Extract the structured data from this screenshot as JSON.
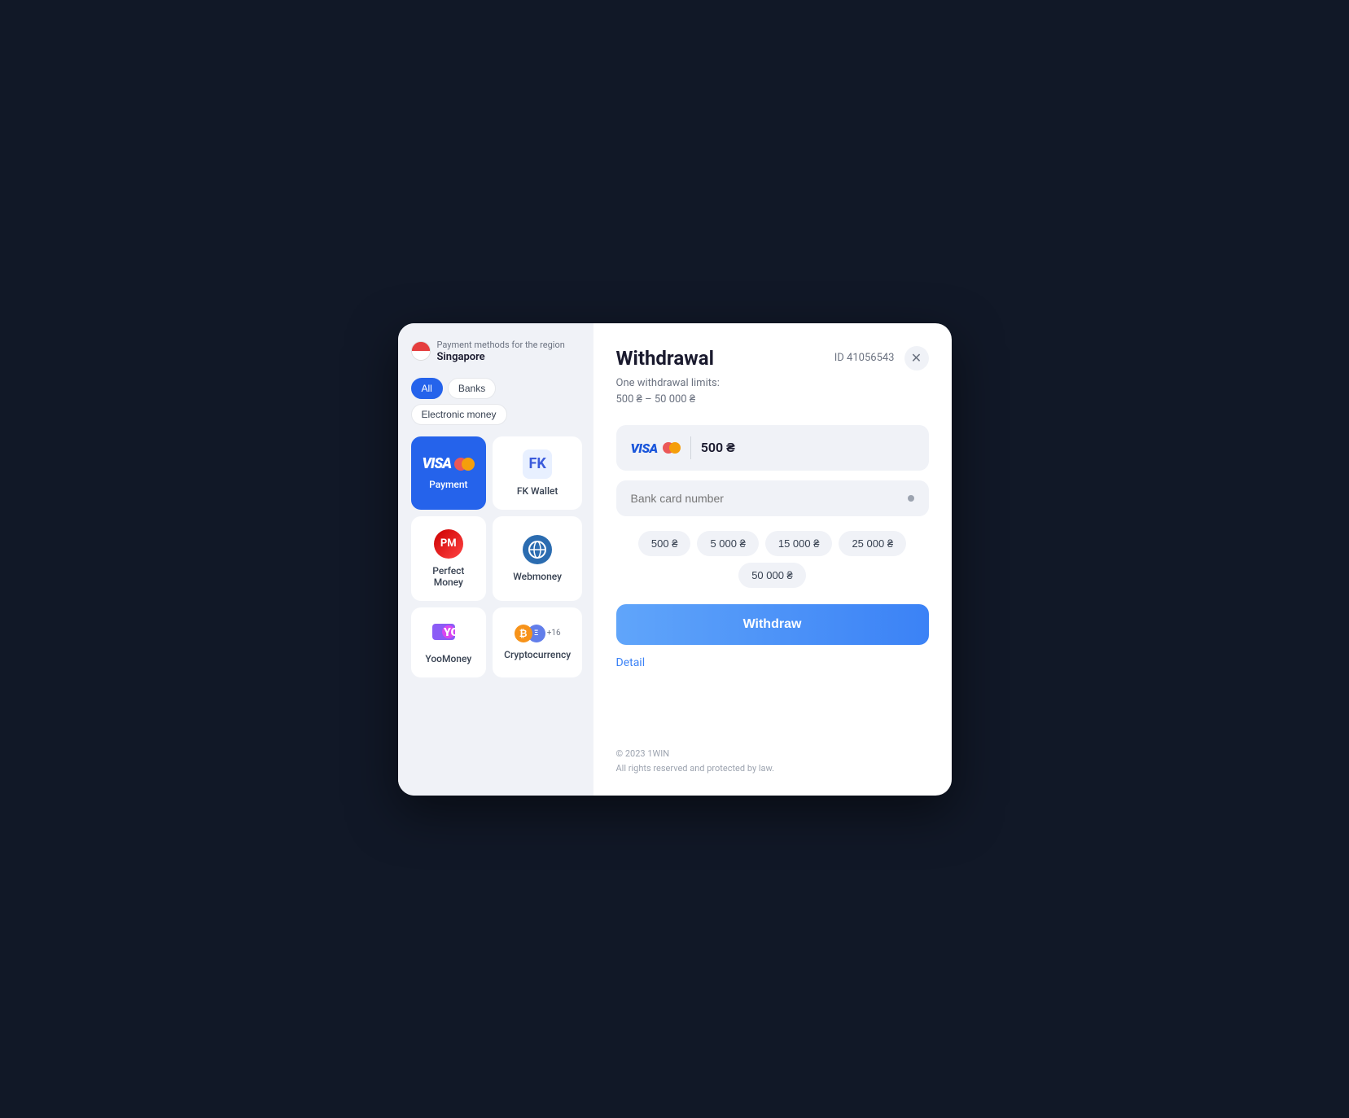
{
  "page": {
    "bg_color": "#111827"
  },
  "modal": {
    "left": {
      "region_label": "Payment methods for the region",
      "region_name": "Singapore",
      "filters": [
        {
          "id": "all",
          "label": "All",
          "active": true
        },
        {
          "id": "banks",
          "label": "Banks",
          "active": false
        },
        {
          "id": "electronic",
          "label": "Electronic money",
          "active": false
        }
      ],
      "payment_methods": [
        {
          "id": "visa",
          "label": "Payment",
          "selected": true
        },
        {
          "id": "fk",
          "label": "FK Wallet",
          "selected": false
        },
        {
          "id": "pm",
          "label": "Perfect Money",
          "selected": false
        },
        {
          "id": "webmoney",
          "label": "Webmoney",
          "selected": false
        },
        {
          "id": "yoo",
          "label": "YooMoney",
          "selected": false
        },
        {
          "id": "crypto",
          "label": "Cryptocurrency",
          "selected": false
        }
      ]
    },
    "right": {
      "title": "Withdrawal",
      "id_label": "ID 41056543",
      "limits_line1": "One withdrawal limits:",
      "limits_line2": "500 ₴ – 50 000 ₴",
      "selected_method": "VISA",
      "amount": "500 ₴",
      "card_input_placeholder": "Bank card number",
      "quick_amounts": [
        "500 ₴",
        "5 000 ₴",
        "15 000 ₴",
        "25 000 ₴",
        "50 000 ₴"
      ],
      "withdraw_button_label": "Withdraw",
      "detail_link_label": "Detail",
      "footer_line1": "© 2023 1WIN",
      "footer_line2": "All rights reserved and protected by law."
    }
  }
}
